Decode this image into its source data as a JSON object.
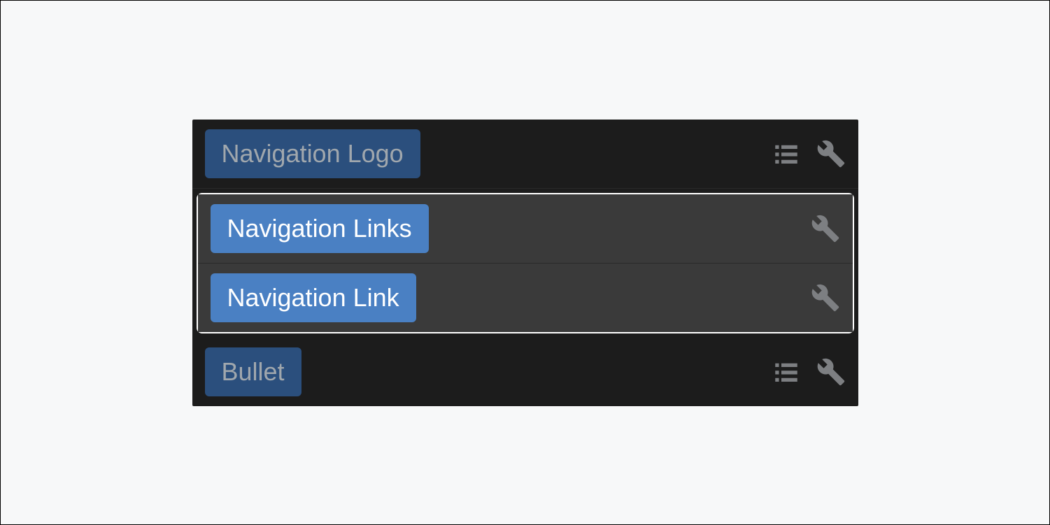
{
  "rows": [
    {
      "label": "Navigation Logo",
      "showList": true,
      "selected": false
    },
    {
      "label": "Navigation Links",
      "showList": false,
      "selected": true
    },
    {
      "label": "Navigation Link",
      "showList": false,
      "selected": true
    },
    {
      "label": "Bullet",
      "showList": true,
      "selected": false
    }
  ]
}
